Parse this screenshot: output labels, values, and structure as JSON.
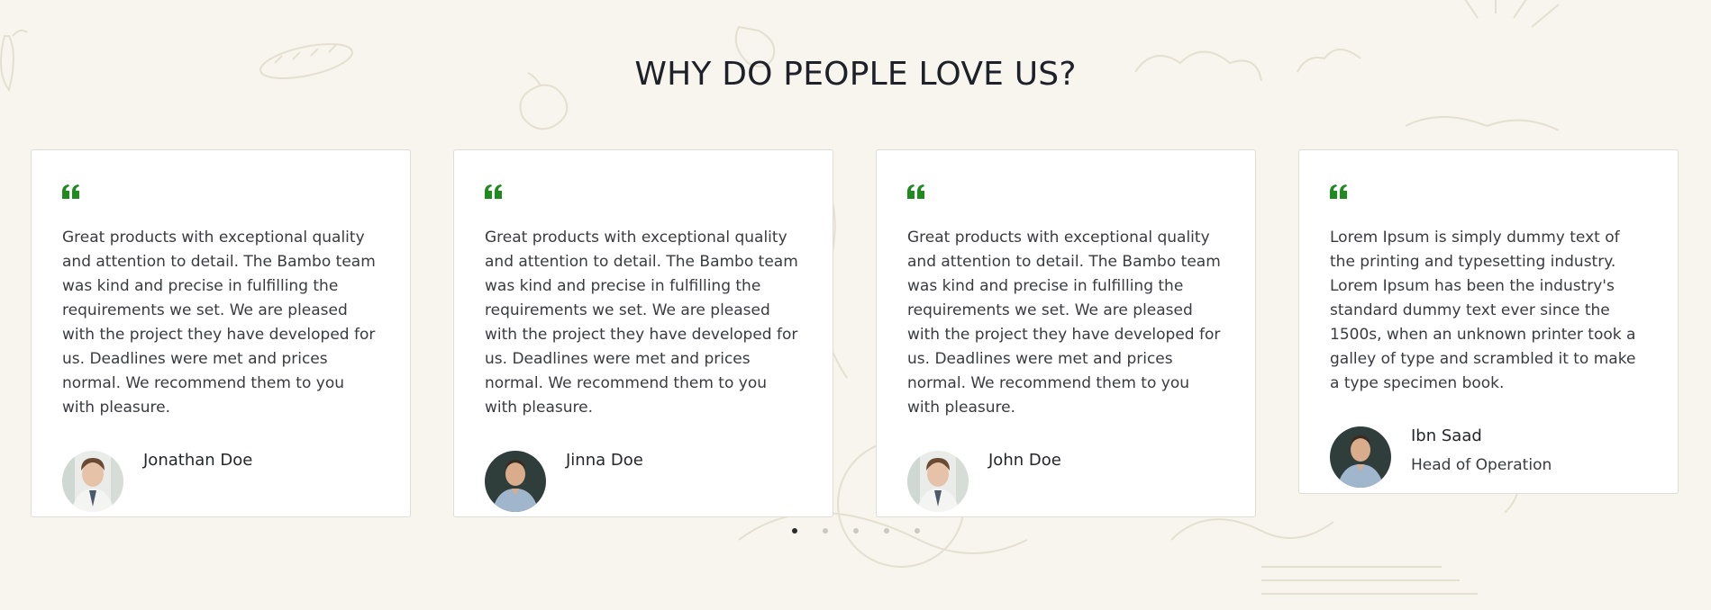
{
  "section": {
    "title": "WHY DO PEOPLE LOVE US?"
  },
  "colors": {
    "background": "#f7f5ee",
    "quote_icon": "#1f8a1f",
    "card_bg": "#ffffff",
    "dot_active": "#2b2b2b",
    "dot_inactive": "#c9c8c2"
  },
  "testimonials": [
    {
      "quote": "Great products with exceptional quality and attention to detail. The Bambo team was kind and precise in fulfilling the requirements we set. We are pleased with the project they have developed for us. Deadlines were met and prices normal. We recommend them to you with pleasure.",
      "name": "Jonathan Doe",
      "role": "",
      "avatar_icon": "woman-avatar"
    },
    {
      "quote": "Great products with exceptional quality and attention to detail. The Bambo team was kind and precise in fulfilling the requirements we set. We are pleased with the project they have developed for us. Deadlines were met and prices normal. We recommend them to you with pleasure.",
      "name": "Jinna Doe",
      "role": "",
      "avatar_icon": "man-avatar"
    },
    {
      "quote": "Great products with exceptional quality and attention to detail. The Bambo team was kind and precise in fulfilling the requirements we set. We are pleased with the project they have developed for us. Deadlines were met and prices normal. We recommend them to you with pleasure.",
      "name": "John Doe",
      "role": "",
      "avatar_icon": "woman-avatar"
    },
    {
      "quote": "Lorem Ipsum is simply dummy text of the printing and typesetting industry. Lorem Ipsum has been the industry's standard dummy text ever since the 1500s, when an unknown printer took a galley of type and scrambled it to make a type specimen book.",
      "name": "Ibn Saad",
      "role": "Head of Operation",
      "avatar_icon": "man-avatar"
    }
  ],
  "carousel": {
    "dot_count": 5,
    "active_index": 0
  }
}
